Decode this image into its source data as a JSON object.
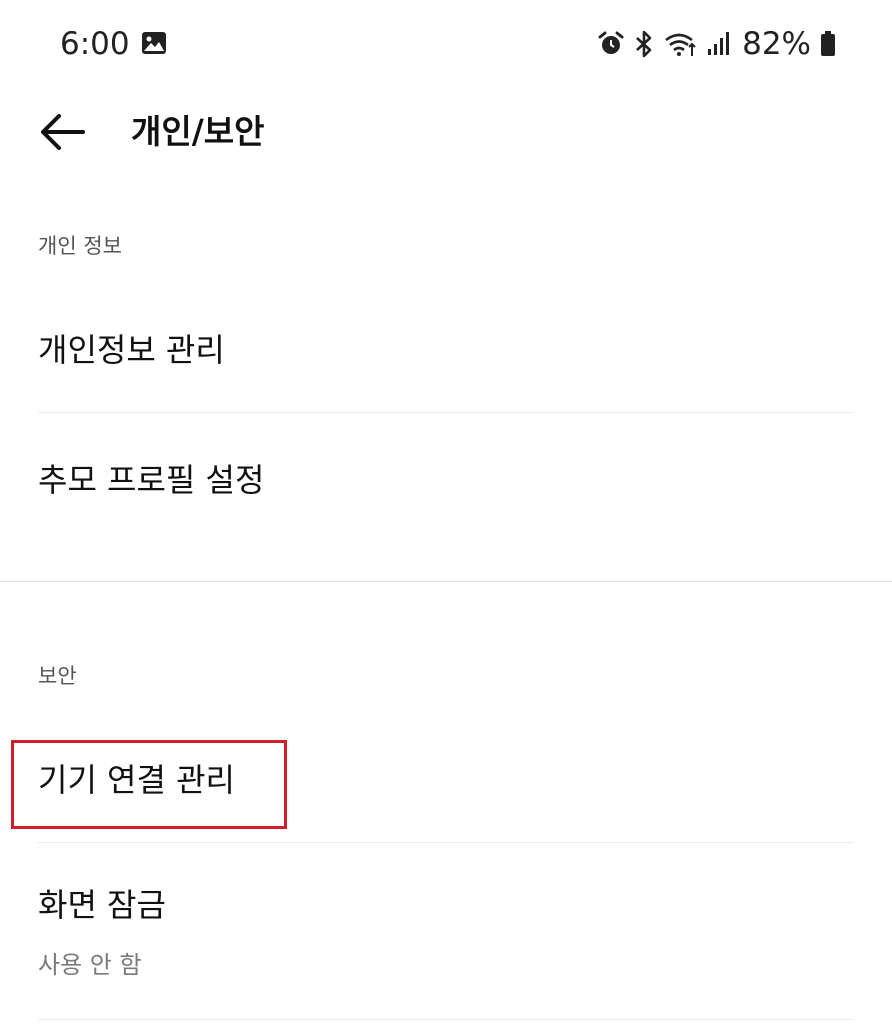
{
  "status_bar": {
    "time": "6:00",
    "battery": "82%",
    "icons": [
      "gallery-icon",
      "alarm-icon",
      "bluetooth-icon",
      "wifi-icon",
      "signal-icon",
      "battery-icon"
    ]
  },
  "app_bar": {
    "back_icon": "back-arrow-icon",
    "title": "개인/보안"
  },
  "sections": {
    "personal": {
      "header": "개인 정보",
      "items": [
        {
          "label": "개인정보 관리"
        },
        {
          "label": "추모 프로필 설정"
        }
      ]
    },
    "security": {
      "header": "보안",
      "items": [
        {
          "label": "기기 연결 관리"
        },
        {
          "label": "화면 잠금",
          "subtitle": "사용 안 함"
        }
      ]
    }
  },
  "colors": {
    "highlight": "#d11f2a",
    "divider": "#ececec",
    "secondary_text": "#7a7a7a"
  }
}
